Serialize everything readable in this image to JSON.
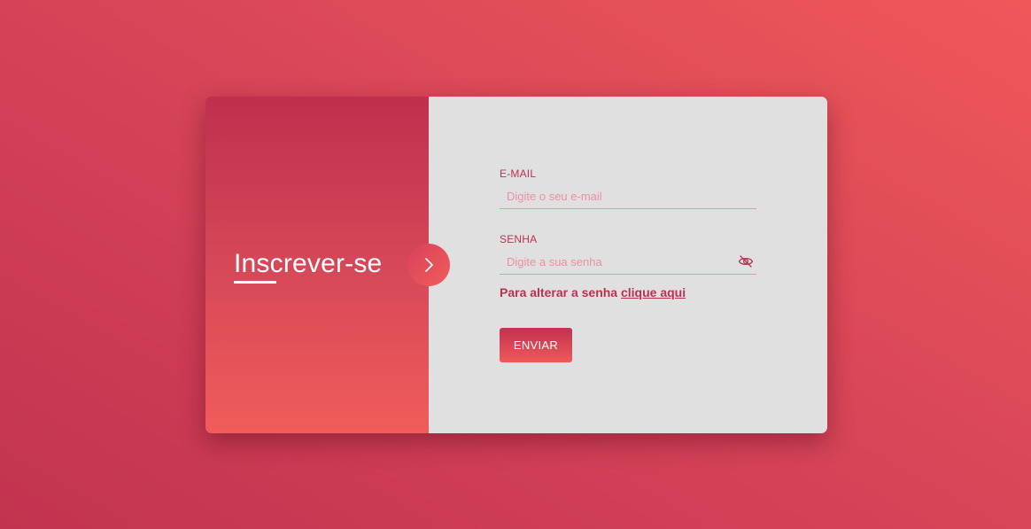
{
  "colors": {
    "accent": "#c0304e",
    "accent_light": "#ef5a5a",
    "panel_bg": "#e0e0e0"
  },
  "left_panel": {
    "title": "Inscrever-se",
    "arrow_icon": "chevron-right-icon"
  },
  "form": {
    "email": {
      "label": "E-MAIL",
      "placeholder": "Digite o seu e-mail",
      "value": ""
    },
    "password": {
      "label": "SENHA",
      "placeholder": "Digite a sua senha",
      "value": "",
      "toggle_icon": "eye-off-icon"
    },
    "forgot": {
      "text": "Para alterar a senha ",
      "link_text": "clique aqui"
    },
    "submit_label": "ENVIAR"
  }
}
